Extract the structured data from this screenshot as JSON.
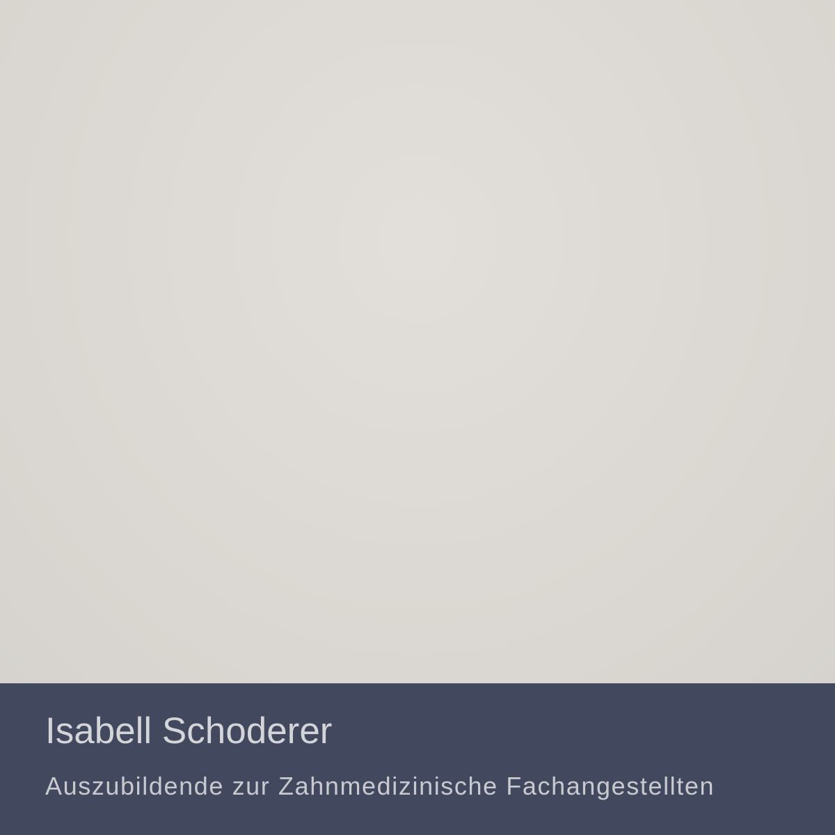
{
  "caption": {
    "name": "Isabell Schoderer",
    "role": "Auszubildende zur Zahnmedizinische Fachangestellten"
  },
  "colors": {
    "background": "#dcd8d3",
    "caption_bar": "#42485e",
    "caption_text": "#d4d5d8"
  }
}
